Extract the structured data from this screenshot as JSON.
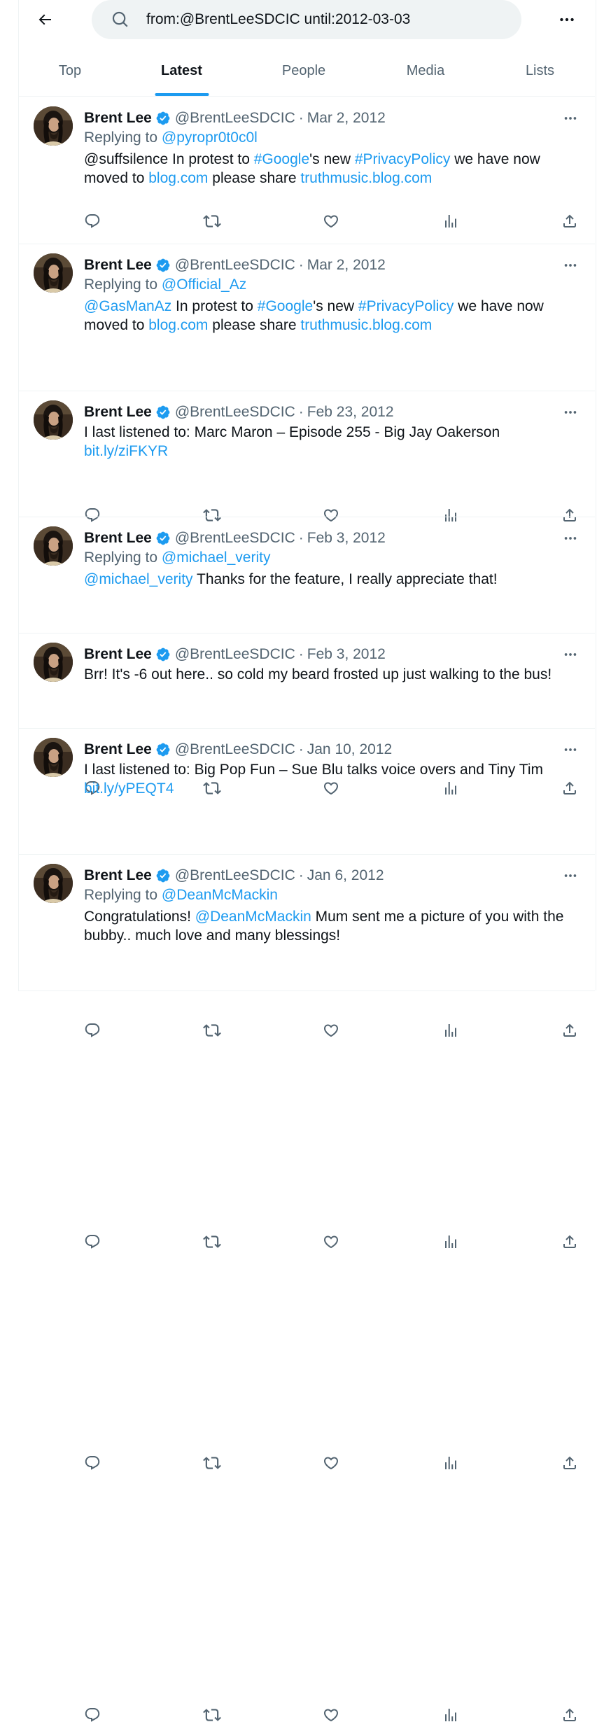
{
  "search": {
    "query": "from:@BrentLeeSDCIC until:2012-03-03"
  },
  "tabs": [
    {
      "label": "Top"
    },
    {
      "label": "Latest"
    },
    {
      "label": "People"
    },
    {
      "label": "Media"
    },
    {
      "label": "Lists"
    }
  ],
  "active_tab": "Latest",
  "colors": {
    "accent": "#1d9bf0",
    "text": "#0f1419",
    "secondary": "#536471"
  },
  "tweets": [
    {
      "name": "Brent Lee",
      "handle": "@BrentLeeSDCIC",
      "sep": "·",
      "date": "Mar 2, 2012",
      "replying_prefix": "Replying to ",
      "replying_to": "@pyropr0t0c0l",
      "line1": [
        {
          "t": "@suffsilence In protest to "
        },
        {
          "t": "#Google",
          "link": true
        },
        {
          "t": "'s new "
        },
        {
          "t": "#PrivacyPolicy",
          "link": true
        },
        {
          "t": " we have now"
        }
      ],
      "line2": [
        {
          "t": "moved to "
        },
        {
          "t": "blog.com",
          "link": true
        },
        {
          "t": " please share "
        },
        {
          "t": "truthmusic.blog.com",
          "link": true
        }
      ]
    },
    {
      "name": "Brent Lee",
      "handle": "@BrentLeeSDCIC",
      "sep": "·",
      "date": "Mar 2, 2012",
      "replying_prefix": "Replying to ",
      "replying_to": "@Official_Az",
      "line1": [
        {
          "t": "@GasManAz",
          "link": true
        },
        {
          "t": " In protest to "
        },
        {
          "t": "#Google",
          "link": true
        },
        {
          "t": "'s new "
        },
        {
          "t": "#PrivacyPolicy",
          "link": true
        },
        {
          "t": " we have now"
        }
      ],
      "line2": [
        {
          "t": "moved to "
        },
        {
          "t": "blog.com",
          "link": true
        },
        {
          "t": " please share "
        },
        {
          "t": "truthmusic.blog.com",
          "link": true
        }
      ]
    },
    {
      "name": "Brent Lee",
      "handle": "@BrentLeeSDCIC",
      "sep": "·",
      "date": "Feb 23, 2012",
      "line1": [
        {
          "t": "I last listened to: Marc Maron – Episode 255 - Big Jay Oakerson"
        }
      ],
      "line2": [
        {
          "t": "bit.ly/ziFKYR",
          "link": true
        }
      ]
    },
    {
      "name": "Brent Lee",
      "handle": "@BrentLeeSDCIC",
      "sep": "·",
      "date": "Feb 3, 2012",
      "replying_prefix": "Replying to ",
      "replying_to": "@michael_verity",
      "line1": [
        {
          "t": "@michael_verity",
          "link": true
        },
        {
          "t": " Thanks for the feature, I really appreciate that!"
        }
      ]
    },
    {
      "name": "Brent Lee",
      "handle": "@BrentLeeSDCIC",
      "sep": "·",
      "date": "Feb 3, 2012",
      "line1": [
        {
          "t": "Brr! It's -6 out here.. so cold my beard frosted up just walking to the bus!"
        }
      ]
    },
    {
      "name": "Brent Lee",
      "handle": "@BrentLeeSDCIC",
      "sep": "·",
      "date": "Jan 10, 2012",
      "line1": [
        {
          "t": "I last listened to: Big Pop Fun – Sue Blu talks voice overs and Tiny Tim"
        }
      ],
      "line2": [
        {
          "t": "bit.ly/yPEQT4",
          "link": true
        }
      ]
    },
    {
      "name": "Brent Lee",
      "handle": "@BrentLeeSDCIC",
      "sep": "·",
      "date": "Jan 6, 2012",
      "replying_prefix": "Replying to ",
      "replying_to": "@DeanMcMackin",
      "line1": [
        {
          "t": "Congratulations! "
        },
        {
          "t": "@DeanMcMackin",
          "link": true
        },
        {
          "t": " Mum sent me a picture of you with the"
        }
      ],
      "line2": [
        {
          "t": "bubby.. much love and many blessings!"
        }
      ]
    }
  ],
  "icons": {
    "back": "arrow-left-icon",
    "search": "search-icon",
    "more": "more-horizontal-icon",
    "verified": "verified-badge-icon",
    "reply": "reply-icon",
    "retweet": "retweet-icon",
    "like": "heart-icon",
    "views": "views-icon",
    "share": "share-icon"
  }
}
